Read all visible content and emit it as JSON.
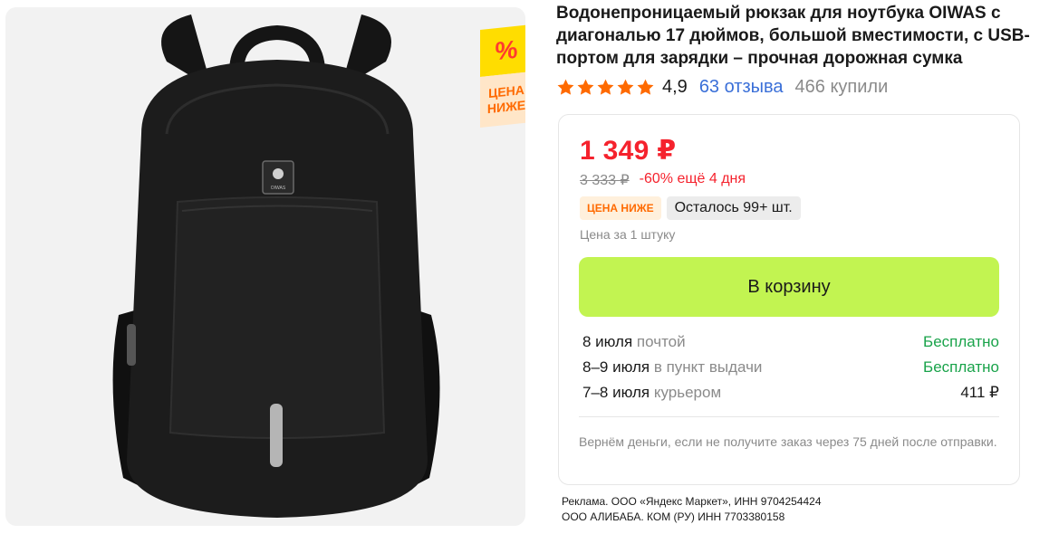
{
  "product": {
    "title": "Водонепроницаемый рюкзак для ноутбука OIWAS с диагональю 17 дюймов, большой вместимости, с USB-портом для зарядки – прочная дорожная сумка",
    "image_brand_text": "OIWAS"
  },
  "promo_badge": {
    "symbol": "%",
    "line1": "ЦЕНА",
    "line2": "НИЖЕ"
  },
  "rating": {
    "stars": 5,
    "value": "4,9",
    "reviews": "63 отзыва",
    "bought": "466 купили",
    "star_color": "#ff6a00"
  },
  "offer": {
    "price": "1 349 ₽",
    "old_price": "3 333 ₽",
    "discount": "-60% ещё 4 дня",
    "chip_price_lower": "ЦЕНА НИЖЕ",
    "chip_stock": "Осталось 99+ шт.",
    "unit_note": "Цена за 1 штуку",
    "cart_button": "В корзину",
    "delivery": [
      {
        "when": "8 июля",
        "method": "почтой",
        "cost": "Бесплатно",
        "free": true
      },
      {
        "when": "8–9 июля",
        "method": "в пункт выдачи",
        "cost": "Бесплатно",
        "free": true
      },
      {
        "when": "7–8 июля",
        "method": "курьером",
        "cost": "411 ₽",
        "free": false
      }
    ],
    "guarantee": "Вернём деньги, если не получите заказ через 75 дней после отправки."
  },
  "ad": {
    "line1": "Реклама. ООО «Яндекс Маркет», ИНН 9704254424",
    "line2": "ООО АЛИБАБА. КОМ (РУ) ИНН 7703380158"
  },
  "colors": {
    "price_red": "#f5222d",
    "cart_green": "#c2f451",
    "free_green": "#19a34a",
    "link_blue": "#3a6fd8",
    "badge_yellow": "#ffdd00",
    "badge_orange": "#ff6a00"
  }
}
